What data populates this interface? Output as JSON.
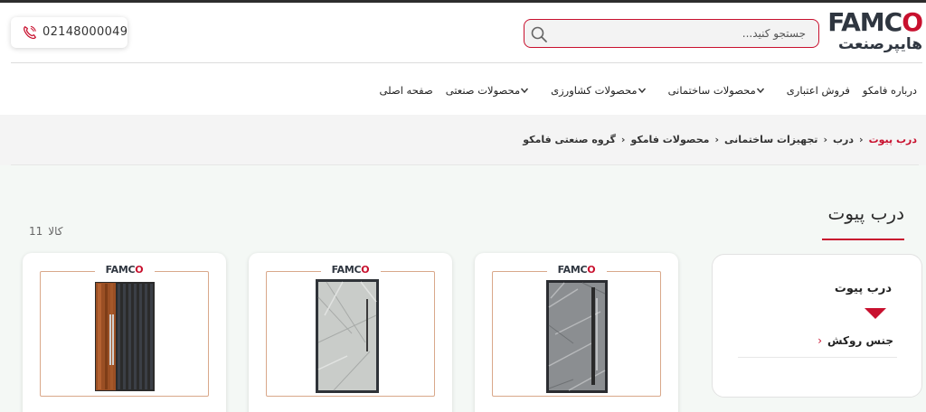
{
  "header": {
    "logo": {
      "word": "FAMCO",
      "sub": "هایپرصنعت"
    },
    "search": {
      "placeholder": "جستجو کنید..."
    },
    "phone": {
      "number": "02148000049"
    }
  },
  "nav": {
    "items": [
      {
        "label": "صفحه اصلی",
        "has_dropdown": false
      },
      {
        "label": "محصولات صنعتی",
        "has_dropdown": true
      },
      {
        "label": "محصولات کشاورزی",
        "has_dropdown": true
      },
      {
        "label": "محصولات ساختمانی",
        "has_dropdown": true
      },
      {
        "label": "فروش اعتباری",
        "has_dropdown": false
      },
      {
        "label": "درباره فامکو",
        "has_dropdown": false
      }
    ]
  },
  "breadcrumb": {
    "items": [
      "گروه صنعتی فامکو",
      "محصولات فامکو",
      "تجهیزات ساختمانی",
      "درب"
    ],
    "current": "درب پیوت"
  },
  "page": {
    "title": "درب پیوت",
    "count_number": "11",
    "count_unit": "کالا"
  },
  "filter": {
    "title": "درب پیوت",
    "option": "جنس روکش"
  },
  "products": [
    {
      "brand": "FAMCO",
      "door_style": "dark-stone"
    },
    {
      "brand": "FAMCO",
      "door_style": "light-stone"
    },
    {
      "brand": "FAMCO",
      "door_style": "wood-black"
    }
  ],
  "colors": {
    "accent": "#c8102e",
    "frame": "#d9a88a",
    "content_bg": "#f4f8f5"
  }
}
